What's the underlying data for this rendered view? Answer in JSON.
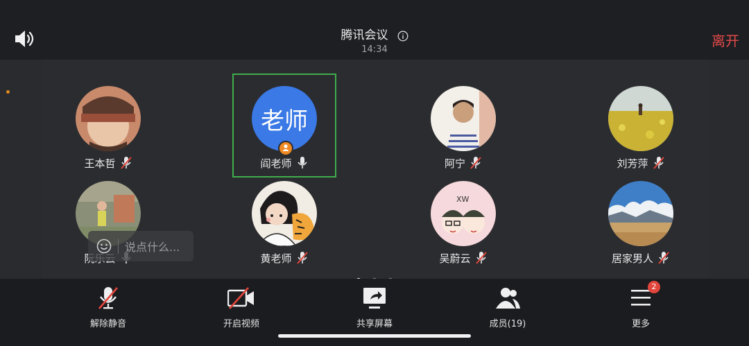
{
  "header": {
    "title": "腾讯会议",
    "time": "14:34",
    "leave_label": "离开",
    "speaker_icon": "speaker-icon",
    "info_icon": "info-icon"
  },
  "colors": {
    "leave": "#e24a4a",
    "speaking_border": "#3fae4c",
    "text_avatar_bg": "#3a79e6",
    "host_badge": "#f08a24",
    "badge": "#e2453c",
    "muted_slash": "#e2453c"
  },
  "participants": [
    {
      "name": "王本哲",
      "mic": "muted"
    },
    {
      "name": "阎老师",
      "mic": "on",
      "avatar_text": "老师",
      "speaking": true,
      "host": true
    },
    {
      "name": "阿宁",
      "mic": "muted"
    },
    {
      "name": "刘芳萍",
      "mic": "muted"
    },
    {
      "name": "阮乐云",
      "mic": "on"
    },
    {
      "name": "黄老师",
      "mic": "muted"
    },
    {
      "name": "吴蔚云",
      "mic": "muted"
    },
    {
      "name": "居家男人",
      "mic": "muted"
    }
  ],
  "chat": {
    "placeholder": "说点什么..."
  },
  "pager": {
    "pages": 3,
    "current": 1
  },
  "toolbar": {
    "unmute_label": "解除静音",
    "video_label": "开启视频",
    "share_label": "共享屏幕",
    "members_label": "成员(19)",
    "more_label": "更多",
    "more_badge": "2"
  }
}
